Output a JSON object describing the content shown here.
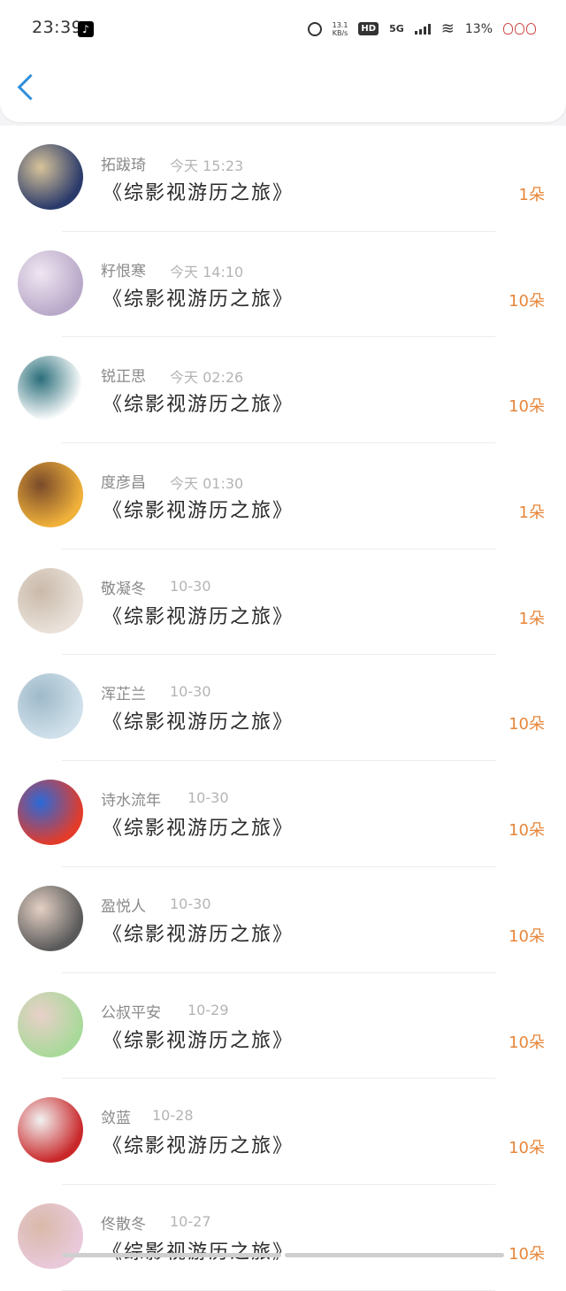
{
  "status_bar": {
    "time": "23:39",
    "net_speed_value": "13.1",
    "net_speed_unit": "KB/s",
    "hd": "HD",
    "network": "5G",
    "battery": "13%"
  },
  "items": [
    {
      "name": "拓跋琦",
      "time": "今天 15:23",
      "book": "《综影视游历之旅》",
      "amount": "1朵",
      "avatar_colors": [
        "#2a3a6a",
        "#d8c49a"
      ]
    },
    {
      "name": "籽恨寒",
      "time": "今天 14:10",
      "book": "《综影视游历之旅》",
      "amount": "10朵",
      "avatar_colors": [
        "#b9a9c9",
        "#efe6f2"
      ]
    },
    {
      "name": "锐正思",
      "time": "今天 02:26",
      "book": "《综影视游历之旅》",
      "amount": "10朵",
      "avatar_colors": [
        "#ffffff",
        "#2a6e7a"
      ]
    },
    {
      "name": "度彦昌",
      "time": "今天 01:30",
      "book": "《综影视游历之旅》",
      "amount": "1朵",
      "avatar_colors": [
        "#f0b13a",
        "#7a4a2a"
      ]
    },
    {
      "name": "敬凝冬",
      "time": "10-30",
      "book": "《综影视游历之旅》",
      "amount": "1朵",
      "avatar_colors": [
        "#e9e1d9",
        "#c9b9a9"
      ]
    },
    {
      "name": "浑芷兰",
      "time": "10-30",
      "book": "《综影视游历之旅》",
      "amount": "10朵",
      "avatar_colors": [
        "#cfe0ea",
        "#9fb9c9"
      ]
    },
    {
      "name": "诗水流年",
      "time": "10-30",
      "book": "《综影视游历之旅》",
      "amount": "10朵",
      "avatar_colors": [
        "#e33b2a",
        "#2a6ad9"
      ]
    },
    {
      "name": "盈悦人",
      "time": "10-30",
      "book": "《综影视游历之旅》",
      "amount": "10朵",
      "avatar_colors": [
        "#5a5a5a",
        "#e4d0c4"
      ]
    },
    {
      "name": "公叔平安",
      "time": "10-29",
      "book": "《综影视游历之旅》",
      "amount": "10朵",
      "avatar_colors": [
        "#a9d99a",
        "#e9d0c9"
      ]
    },
    {
      "name": "敛蓝",
      "time": "10-28",
      "book": "《综影视游历之旅》",
      "amount": "10朵",
      "avatar_colors": [
        "#c9282a",
        "#f2f2f2"
      ]
    },
    {
      "name": "佟散冬",
      "time": "10-27",
      "book": "《综影视游历之旅》",
      "amount": "10朵",
      "avatar_colors": [
        "#e9c9d9",
        "#d9b9a9"
      ]
    }
  ]
}
